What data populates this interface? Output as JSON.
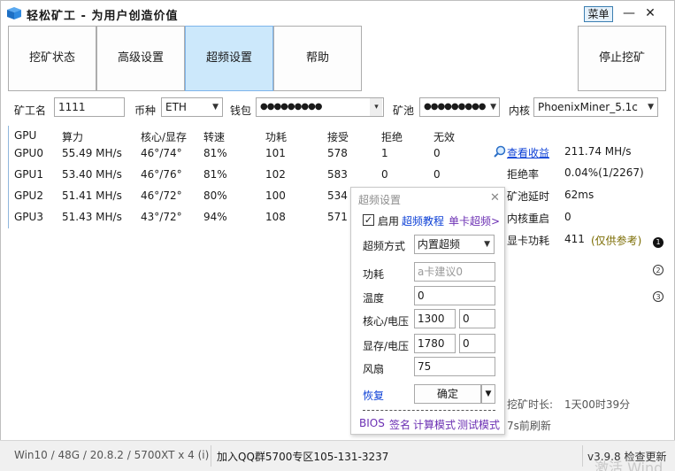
{
  "title": "轻松矿工 - 为用户创造价值",
  "menu_label": "菜单",
  "window_controls": {
    "minimize": "—",
    "maximize": "☐",
    "close": "✕"
  },
  "tabs": [
    {
      "label": "挖矿状态"
    },
    {
      "label": "高级设置"
    },
    {
      "label": "超频设置"
    },
    {
      "label": "帮助"
    }
  ],
  "stop_button": "停止挖矿",
  "form": {
    "miner_name_label": "矿工名",
    "miner_name_value": "1111",
    "coin_label": "币种",
    "coin_value": "ETH",
    "wallet_label": "钱包",
    "wallet_value": "●●●●●●●●●",
    "pool_label": "矿池",
    "pool_value": "●●●●●●●●●",
    "kernel_label": "内核",
    "kernel_value": "PhoenixMiner_5.1c"
  },
  "table": {
    "headers": [
      "GPU",
      "算力",
      "核心/显存",
      "转速",
      "功耗",
      "接受",
      "拒绝",
      "无效"
    ],
    "rows": [
      [
        "GPU0",
        "55.49 MH/s",
        "46°/74°",
        "81%",
        "101",
        "578",
        "1",
        "0"
      ],
      [
        "GPU1",
        "53.40 MH/s",
        "46°/76°",
        "81%",
        "102",
        "583",
        "0",
        "0"
      ],
      [
        "GPU2",
        "51.41 MH/s",
        "46°/72°",
        "80%",
        "100",
        "534",
        "",
        ""
      ],
      [
        "GPU3",
        "51.43 MH/s",
        "43°/72°",
        "94%",
        "108",
        "571",
        "",
        ""
      ]
    ]
  },
  "stats": {
    "view_earnings": "查看收益",
    "total_hashrate": "211.74 MH/s",
    "reject_rate_label": "拒绝率",
    "reject_rate_value": "0.04%(1/2267)",
    "pool_latency_label": "矿池延时",
    "pool_latency_value": "62ms",
    "kernel_restart_label": "内核重启",
    "kernel_restart_value": "0",
    "gpu_power_label": "显卡功耗",
    "gpu_power_value": "411",
    "gpu_power_note": "(仅供参考)",
    "mining_time_label": "挖矿时长:",
    "mining_time_value": "1天00时39分",
    "refresh_note": "7s前刷新",
    "markers": [
      "1",
      "2",
      "3"
    ]
  },
  "popup": {
    "title": "超频设置",
    "close": "✕",
    "enable_label": "启用",
    "enable_checked": "✓",
    "tutorial_link": "超频教程",
    "single_card_link": "单卡超频>",
    "mode_label": "超频方式",
    "mode_value": "内置超频",
    "power_label": "功耗",
    "power_placeholder": "a卡建议0",
    "temp_label": "温度",
    "temp_value": "0",
    "core_label": "核心/电压",
    "core_value": "1300",
    "core_voltage": "0",
    "mem_label": "显存/电压",
    "mem_value": "1780",
    "mem_voltage": "0",
    "fan_label": "风扇",
    "fan_value": "75",
    "restore_label": "恢复",
    "confirm_label": "确定",
    "bottom_links": [
      "BIOS",
      "签名",
      "计算模式",
      "测试模式"
    ]
  },
  "statusbar": {
    "system_info": "Win10 / 48G / 20.8.2 / 5700XT x 4 (i)",
    "qq_group": "加入QQ群5700专区105-131-3237",
    "version": "v3.9.8 检查更新"
  },
  "watermark": "激活 Wind",
  "colors": {
    "active_tab": "#cce8fb",
    "link": "#0b3fd6",
    "purple": "#6b2fb3",
    "note": "#7a6b00"
  }
}
